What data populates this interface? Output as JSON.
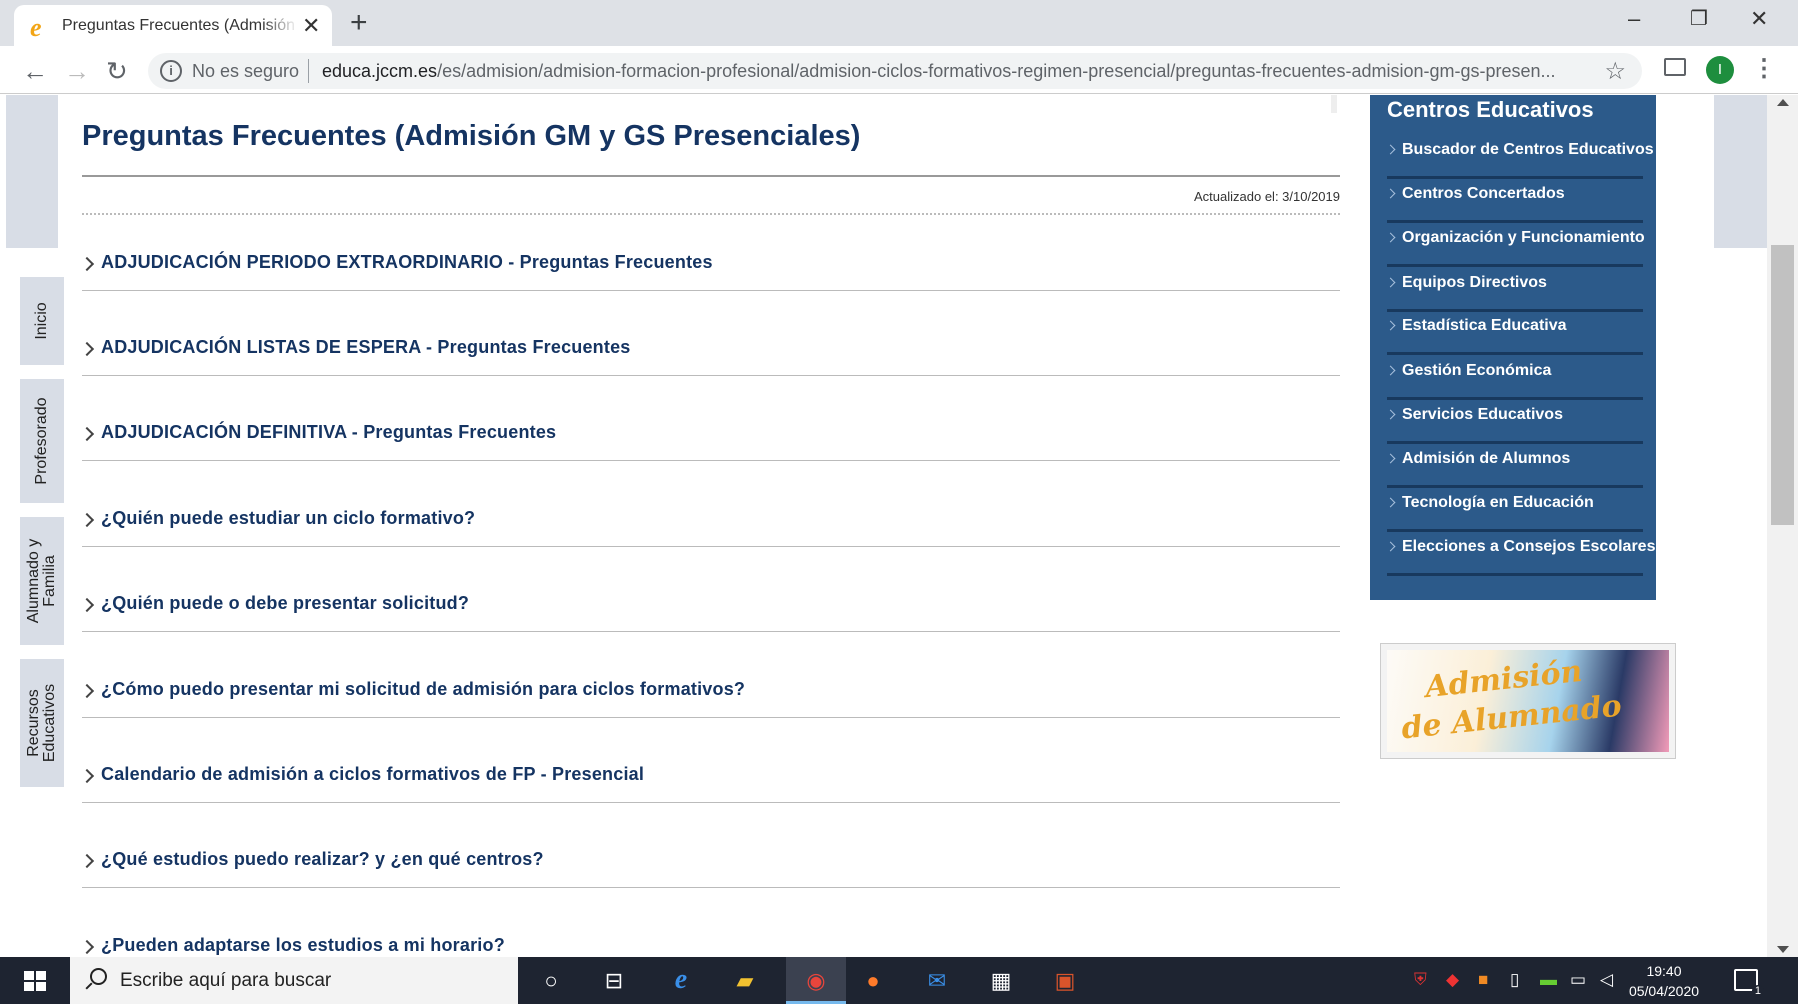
{
  "browser": {
    "tab_title": "Preguntas Frecuentes (Admisión GM y GS Presenciales)",
    "not_secure": "No es seguro",
    "url_domain": "educa.jccm.es",
    "url_path": "/es/admision/admision-formacion-profesional/admision-ciclos-formativos-regimen-presencial/preguntas-frecuentes-admision-gm-gs-presen...",
    "profile_initial": "I"
  },
  "side_tabs": [
    "Inicio",
    "Profesorado",
    "Alumnado y Familia",
    "Recursos Educativos"
  ],
  "page": {
    "title": "Preguntas Frecuentes (Admisión GM y GS Presenciales)",
    "updated": "Actualizado el: 3/10/2019",
    "faqs": [
      "ADJUDICACIÓN PERIODO EXTRAORDINARIO - Preguntas Frecuentes",
      "ADJUDICACIÓN LISTAS DE ESPERA - Preguntas Frecuentes",
      "ADJUDICACIÓN DEFINITIVA - Preguntas Frecuentes",
      "¿Quién puede estudiar un ciclo formativo?",
      "¿Quién puede o debe presentar solicitud?",
      "¿Cómo puedo presentar mi solicitud de admisión para ciclos formativos?",
      "Calendario de admisión a ciclos formativos de FP - Presencial",
      "¿Qué estudios puedo realizar? y ¿en qué centros?",
      "¿Pueden adaptarse los estudios a mi horario?"
    ]
  },
  "panel": {
    "title": "Centros Educativos",
    "links": [
      "Buscador de Centros Educativos",
      "Centros Concertados",
      "Organización y Funcionamiento",
      "Equipos Directivos",
      "Estadística Educativa",
      "Gestión Económica",
      "Servicios Educativos",
      "Admisión de Alumnos",
      "Tecnología en Educación",
      "Elecciones a Consejos Escolares"
    ],
    "banner_line1": "Admisión",
    "banner_line2": "de Alumnado"
  },
  "taskbar": {
    "search_placeholder": "Escribe aquí para buscar",
    "time": "19:40",
    "date": "05/04/2020",
    "notification_count": "1"
  },
  "colors": {
    "title_blue": "#153462",
    "panel_blue": "#2c5a8a",
    "side_tab_grey": "#d8dde6"
  }
}
